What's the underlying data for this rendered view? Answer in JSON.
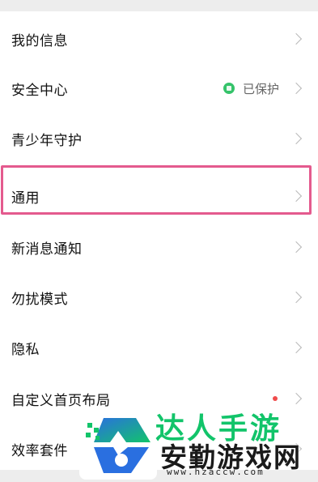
{
  "settings": {
    "items": [
      {
        "label": "我的信息"
      },
      {
        "label": "安全中心",
        "status": "已保护"
      },
      {
        "label": "青少年守护"
      },
      {
        "label": "通用"
      },
      {
        "label": "新消息通知"
      },
      {
        "label": "勿扰模式"
      },
      {
        "label": "隐私"
      },
      {
        "label": "自定义首页布局"
      },
      {
        "label": "效率套件"
      }
    ]
  },
  "watermark": {
    "tagline": "达人手游",
    "name": "安勤游戏网",
    "url": "www.hzaccw.com"
  },
  "colors": {
    "highlight": "#e45a8e",
    "shield": "#35c36a",
    "watermark_green": "#12c46a",
    "watermark_blue": "#2a6fe0"
  }
}
